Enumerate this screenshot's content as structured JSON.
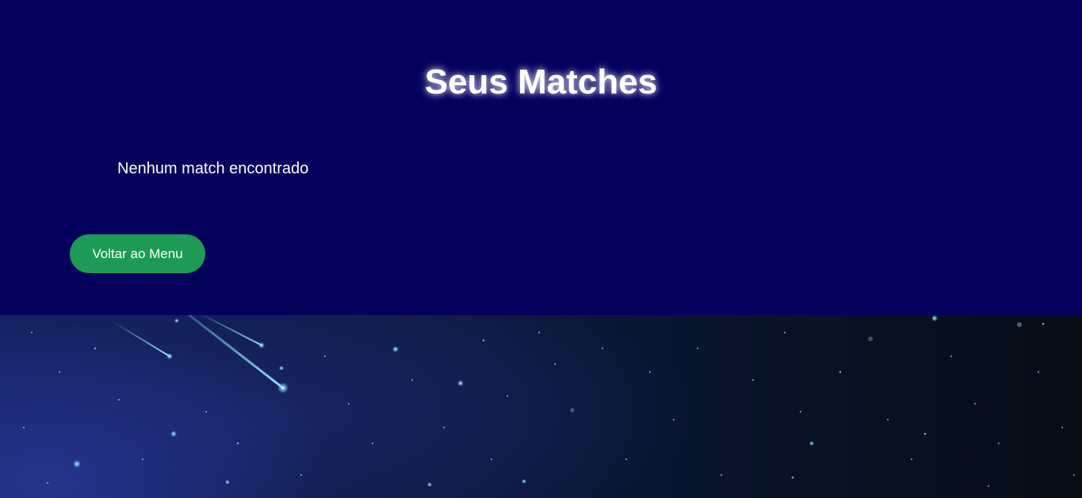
{
  "page": {
    "title": "Seus Matches",
    "empty_message": "Nenhum match encontrado",
    "back_button_label": "Voltar ao Menu"
  },
  "colors": {
    "panel_background": "#03015c",
    "button_background": "#1d9a55",
    "text": "#ffffff"
  },
  "background": {
    "decoration": "starry-night-sky-with-shooting-stars"
  }
}
